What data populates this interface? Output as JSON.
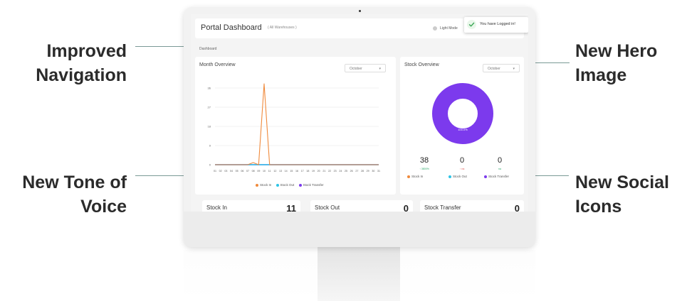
{
  "colors": {
    "accent": "#7c3aed",
    "stock_in": "#f08a3c",
    "stock_out": "#2ec4e6",
    "stock_transfer": "#7c3aed",
    "callout_line": "#7a9a96"
  },
  "callouts": {
    "improved_navigation": [
      "Improved",
      "Navigation"
    ],
    "new_hero_image": [
      "New Hero",
      "Image"
    ],
    "new_tone_of_voice": [
      "New Tone of",
      "Voice"
    ],
    "new_social_icons": [
      "New Social",
      "Icons"
    ]
  },
  "header": {
    "title": "Portal Dashboard",
    "subtitle": "( All Warehouses )",
    "mode_label": "Light Mode",
    "toast": "You have Logged in!"
  },
  "breadcrumb": "Dashboard",
  "month_overview": {
    "title": "Month Overview",
    "select_value": "October"
  },
  "stock_overview": {
    "title": "Stock Overview",
    "select_value": "October",
    "donut_label": "100.0%",
    "stats": [
      {
        "value": "38",
        "sub": "↑ 3800%",
        "label": "Stock In"
      },
      {
        "value": "0",
        "sub": "↑ na",
        "label": "Stock Out"
      },
      {
        "value": "0",
        "sub": "na",
        "label": "Stock Transfer"
      }
    ]
  },
  "bottom_cards": [
    {
      "title": "Stock In",
      "value": "11"
    },
    {
      "title": "Stock Out",
      "value": "0"
    },
    {
      "title": "Stock Transfer",
      "value": "0"
    }
  ],
  "chart_data": {
    "type": "line",
    "x": [
      "01",
      "02",
      "03",
      "04",
      "05",
      "06",
      "07",
      "08",
      "09",
      "10",
      "11",
      "12",
      "13",
      "14",
      "15",
      "16",
      "17",
      "18",
      "19",
      "20",
      "21",
      "22",
      "23",
      "24",
      "25",
      "26",
      "27",
      "28",
      "29",
      "30",
      "31"
    ],
    "yticks": [
      "0",
      "9",
      "18",
      "27",
      "36"
    ],
    "ylim": [
      0,
      36
    ],
    "series": [
      {
        "name": "Stock In",
        "color": "#f08a3c",
        "values": [
          0,
          0,
          0,
          0,
          0,
          0,
          0,
          1,
          0,
          38,
          0,
          0,
          0,
          0,
          0,
          0,
          0,
          0,
          0,
          0,
          0,
          0,
          0,
          0,
          0,
          0,
          0,
          0,
          0,
          0,
          0
        ]
      },
      {
        "name": "Stock Out",
        "color": "#2ec4e6",
        "values": [
          0,
          0,
          0,
          0,
          0,
          0,
          0,
          0,
          0,
          0,
          0,
          0,
          0,
          0,
          0,
          0,
          0,
          0,
          0,
          0,
          0,
          0,
          0,
          0,
          0,
          0,
          0,
          0,
          0,
          0,
          0
        ]
      },
      {
        "name": "Stock Transfer",
        "color": "#7c3aed",
        "values": [
          0,
          0,
          0,
          0,
          0,
          0,
          0,
          0,
          0,
          0,
          0,
          0,
          0,
          0,
          0,
          0,
          0,
          0,
          0,
          0,
          0,
          0,
          0,
          0,
          0,
          0,
          0,
          0,
          0,
          0,
          0
        ]
      }
    ]
  }
}
